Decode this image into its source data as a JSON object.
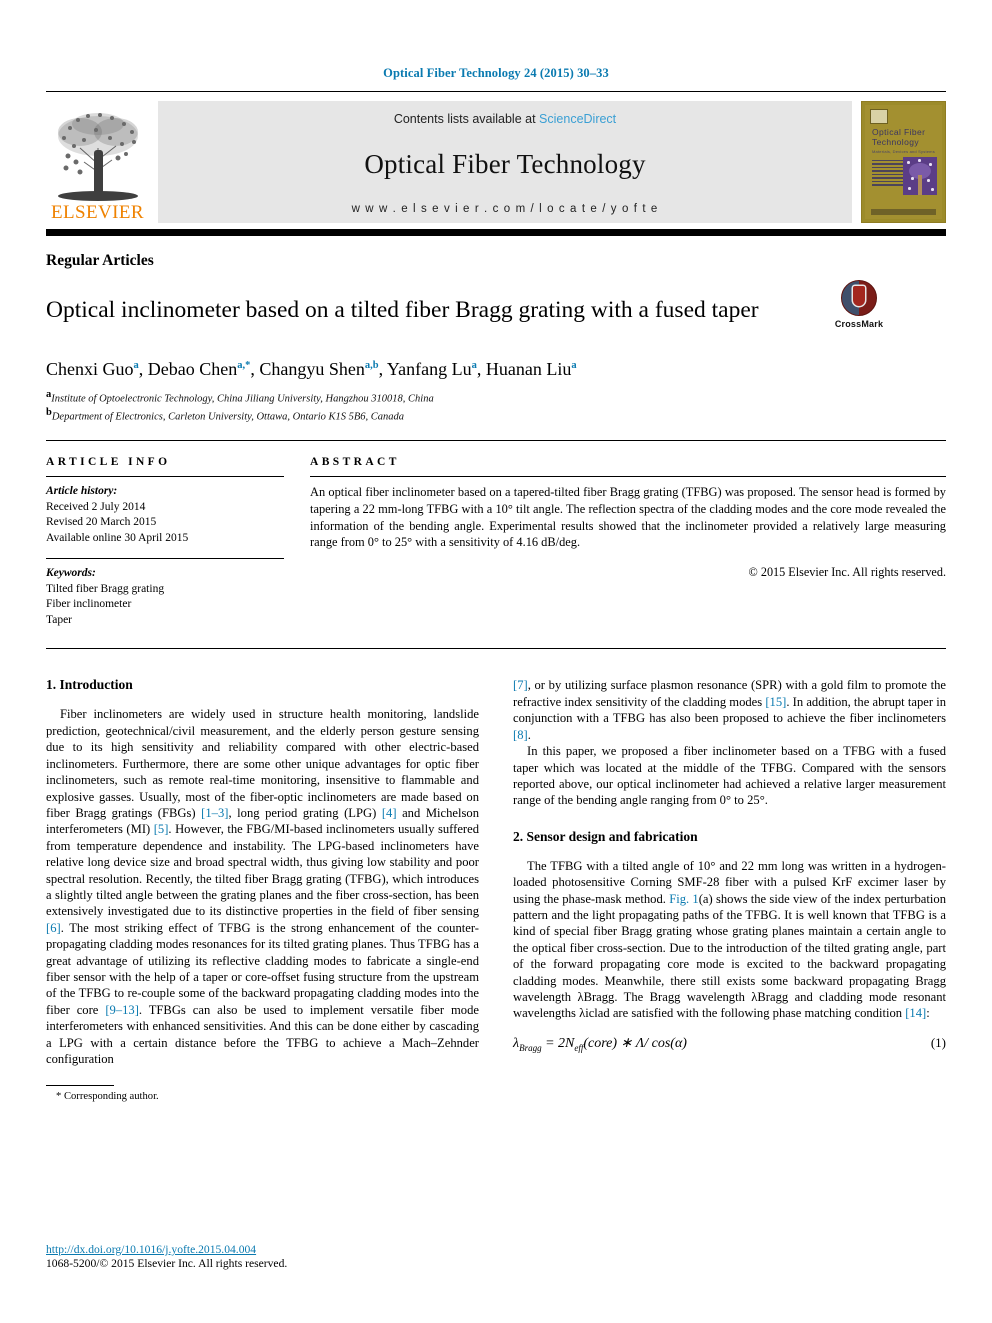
{
  "running_head": "Optical Fiber Technology 24 (2015) 30–33",
  "masthead": {
    "contents_prefix": "Contents lists available at",
    "contents_link": "ScienceDirect",
    "journal_name": "Optical Fiber Technology",
    "journal_url": "w w w . e l s e v i e r . c o m / l o c a t e / y o f t e",
    "publisher_logo_text": "ELSEVIER",
    "cover": {
      "title_line1": "Optical  Fiber",
      "title_line2": "Technology",
      "subtitle": "Materials, Devices and Systems"
    }
  },
  "article": {
    "type": "Regular Articles",
    "title": "Optical inclinometer based on a tilted fiber Bragg grating with a fused taper",
    "crossmark_label": "CrossMark",
    "authors": [
      {
        "name": "Chenxi Guo",
        "marks": "a"
      },
      {
        "name": "Debao Chen",
        "marks": "a,*"
      },
      {
        "name": "Changyu Shen",
        "marks": "a,b"
      },
      {
        "name": "Yanfang Lu",
        "marks": "a"
      },
      {
        "name": "Huanan Liu",
        "marks": "a"
      }
    ],
    "affiliations": [
      {
        "mark": "a",
        "text": "Institute of Optoelectronic Technology, China Jiliang University, Hangzhou 310018, China"
      },
      {
        "mark": "b",
        "text": "Department of Electronics, Carleton University, Ottawa, Ontario K1S 5B6, Canada"
      }
    ]
  },
  "article_info": {
    "heading": "ARTICLE INFO",
    "history_label": "Article history:",
    "history": [
      "Received 2 July 2014",
      "Revised 20 March 2015",
      "Available online 30 April 2015"
    ],
    "keywords_label": "Keywords:",
    "keywords": [
      "Tilted fiber Bragg grating",
      "Fiber inclinometer",
      "Taper"
    ]
  },
  "abstract": {
    "heading": "ABSTRACT",
    "text": "An optical fiber inclinometer based on a tapered-tilted fiber Bragg grating (TFBG) was proposed. The sensor head is formed by tapering a 22 mm-long TFBG with a 10° tilt angle. The reflection spectra of the cladding modes and the core mode revealed the information of the bending angle. Experimental results showed that the inclinometer provided a relatively large measuring range from 0° to 25° with a sensitivity of 4.16 dB/deg.",
    "copyright": "© 2015 Elsevier Inc. All rights reserved."
  },
  "sections": {
    "intro_heading": "1. Introduction",
    "intro_p1_a": "Fiber inclinometers are widely used in structure health monitoring, landslide prediction, geotechnical/civil measurement, and the elderly person gesture sensing due to its high sensitivity and reliability compared with other electric-based inclinometers. Furthermore, there are some other unique advantages for optic fiber inclinometers, such as remote real-time monitoring, insensitive to flammable and explosive gasses. Usually, most of the fiber-optic inclinometers are made based on fiber Bragg gratings (FBGs) ",
    "cite_1_3": "[1–3]",
    "intro_p1_b": ", long period grating (LPG) ",
    "cite_4": "[4]",
    "intro_p1_c": " and Michelson interferometers (MI) ",
    "cite_5": "[5]",
    "intro_p1_d": ". However, the FBG/MI-based inclinometers usually suffered from temperature dependence and instability. The LPG-based inclinometers have relative long device size and broad spectral width, thus giving low stability and poor spectral resolution. Recently, the tilted fiber Bragg grating (TFBG), which introduces a slightly tilted angle between the grating planes and the fiber cross-section, has been extensively investigated due to its distinctive properties in the field of fiber sensing ",
    "cite_6": "[6]",
    "intro_p1_e": ". The most striking effect of TFBG is the strong enhancement of the counter-propagating cladding modes resonances for its tilted grating planes. Thus TFBG has a great advantage of utilizing its reflective cladding modes to fabricate a single-end fiber sensor with the help of a taper or core-offset fusing structure from the upstream of the TFBG to re-couple some of the backward propagating cladding modes into the fiber core ",
    "cite_9_13": "[9–13]",
    "intro_p1_f": ". TFBGs can also be used to implement versatile fiber mode interferometers with enhanced sensitivities. And this can be done either by cascading a LPG with a certain distance before the TFBG to achieve a Mach–Zehnder configuration ",
    "cite_7": "[7]",
    "intro_p1_g": ", or by utilizing surface plasmon resonance (SPR) with a gold film to promote the refractive index sensitivity of the cladding modes ",
    "cite_15": "[15]",
    "intro_p1_h": ". In addition, the abrupt taper in conjunction with a TFBG has also been proposed to achieve the fiber inclinometers ",
    "cite_8": "[8]",
    "intro_p1_i": ".",
    "intro_p2": "In this paper, we proposed a fiber inclinometer based on a TFBG with a fused taper which was located at the middle of the TFBG. Compared with the sensors reported above, our optical inclinometer had achieved a relative larger measurement range of the bending angle ranging from 0° to 25°.",
    "sensor_heading": "2. Sensor design and fabrication",
    "sensor_p1_a": "The TFBG with a tilted angle of 10° and 22 mm long was written in a hydrogen-loaded photosensitive Corning SMF-28 fiber with a pulsed KrF excimer laser by using the phase-mask method. ",
    "cite_fig1": "Fig. 1",
    "sensor_p1_b": "(a) shows the side view of the index perturbation pattern and the light propagating paths of the TFBG. It is well known that TFBG is a kind of special fiber Bragg grating whose grating planes maintain a certain angle to the optical fiber cross-section. Due to the introduction of the tilted grating angle, part of the forward propagating core mode is excited to the backward propagating cladding modes. Meanwhile, there still exists some backward propagating Bragg wavelength λBragg. The Bragg wavelength λBragg and cladding mode resonant wavelengths λiclad are satisfied with the following phase matching condition ",
    "cite_14": "[14]",
    "sensor_p1_c": ":"
  },
  "equation": {
    "lhs_lambda": "λ",
    "lhs_sub": "Bragg",
    "eq": "= 2N",
    "n_sub": "eff",
    "rest": "(core) ∗ Λ/ cos(α)",
    "number": "(1)"
  },
  "footnote": {
    "corresponding": "* Corresponding author."
  },
  "footer": {
    "doi": "http://dx.doi.org/10.1016/j.yofte.2015.04.004",
    "issn": "1068-5200/© 2015 Elsevier Inc. All rights reserved."
  },
  "colors": {
    "link_blue": "#0a7ab0",
    "sciencedirect_blue": "#3a9fd4",
    "elsevier_orange": "#ef8200",
    "cover_olive": "#9c8b2a"
  }
}
